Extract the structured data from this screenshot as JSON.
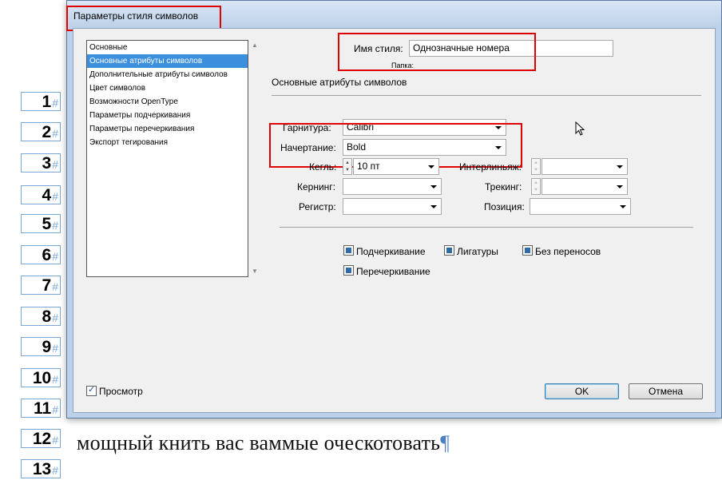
{
  "dialog": {
    "title": "Параметры стиля символов",
    "list_items": [
      "Основные",
      "Основные атрибуты символов",
      "Дополнительные атрибуты символов",
      "Цвет символов",
      "Возможности OpenType",
      "Параметры подчеркивания",
      "Параметры перечеркивания",
      "Экспорт тегирования"
    ],
    "selected_item": "Основные атрибуты символов",
    "style_name_label": "Имя стиля:",
    "style_name_value": "Однозначные номера",
    "folder_label": "Папка:",
    "section_title": "Основные атрибуты символов",
    "fields": {
      "font_family_label": "Гарнитура:",
      "font_family_value": "Calibri",
      "font_style_label": "Начертание:",
      "font_style_value": "Bold",
      "size_label": "Кегль:",
      "size_value": "10 пт",
      "leading_label": "Интерлиньяж:",
      "leading_value": "",
      "kerning_label": "Кернинг:",
      "kerning_value": "",
      "tracking_label": "Трекинг:",
      "tracking_value": "",
      "case_label": "Регистр:",
      "case_value": "",
      "position_label": "Позиция:",
      "position_value": ""
    },
    "checkboxes": {
      "underline": "Подчеркивание",
      "ligatures": "Лигатуры",
      "no_break": "Без переносов",
      "strikethrough": "Перечеркивание"
    },
    "preview_label": "Просмотр",
    "ok_label": "OK",
    "cancel_label": "Отмена"
  },
  "document": {
    "numbers": [
      "1",
      "2",
      "3",
      "4",
      "5",
      "6",
      "7",
      "8",
      "9",
      "10",
      "11",
      "12",
      "13"
    ],
    "text_line": "мощный книть вас ваммые оческотовать",
    "pilcrow": "¶"
  },
  "colors": {
    "highlight": "#e00000",
    "selection": "#3b8fdc",
    "frame_blue": "#7aa7d6"
  }
}
